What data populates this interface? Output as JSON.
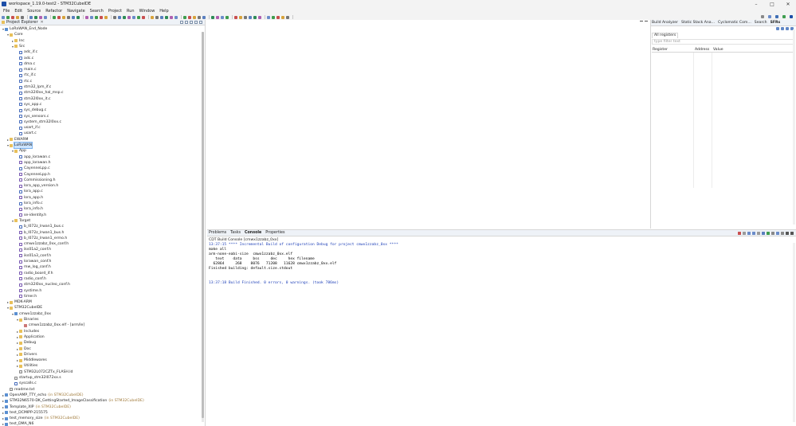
{
  "window": {
    "title": "workspace_1.19.0-test2 - STM32CubeIDE",
    "minimize": "–",
    "maximize": "□",
    "close": "✕"
  },
  "menu": [
    "File",
    "Edit",
    "Source",
    "Refactor",
    "Navigate",
    "Search",
    "Project",
    "Run",
    "Window",
    "Help"
  ],
  "colors": {
    "accent": "#1d4ea7",
    "selected": "#cce4ff",
    "console_info": "#1d3fb8",
    "decorator": "#a07a3a"
  },
  "project_explorer": {
    "tab_label": "Project Explorer",
    "close": "✕",
    "tree": [
      {
        "label": "LoRaWAN_End_Node",
        "depth": 0,
        "type": "project",
        "expanded": true
      },
      {
        "label": "Core",
        "depth": 1,
        "type": "folder",
        "expanded": true
      },
      {
        "label": "Inc",
        "depth": 2,
        "type": "folder",
        "expanded": false
      },
      {
        "label": "Src",
        "depth": 2,
        "type": "folder",
        "expanded": true
      },
      {
        "label": "adc_if.c",
        "depth": 3,
        "type": "cfile"
      },
      {
        "label": "adc.c",
        "depth": 3,
        "type": "cfile"
      },
      {
        "label": "dma.c",
        "depth": 3,
        "type": "cfile"
      },
      {
        "label": "main.c",
        "depth": 3,
        "type": "cfile"
      },
      {
        "label": "rtc_if.c",
        "depth": 3,
        "type": "cfile"
      },
      {
        "label": "rtc.c",
        "depth": 3,
        "type": "cfile"
      },
      {
        "label": "stm32_lpm_if.c",
        "depth": 3,
        "type": "cfile"
      },
      {
        "label": "stm32l0xx_hal_msp.c",
        "depth": 3,
        "type": "cfile"
      },
      {
        "label": "stm32l0xx_it.c",
        "depth": 3,
        "type": "cfile"
      },
      {
        "label": "sys_app.c",
        "depth": 3,
        "type": "cfile"
      },
      {
        "label": "sys_debug.c",
        "depth": 3,
        "type": "cfile"
      },
      {
        "label": "sys_sensors.c",
        "depth": 3,
        "type": "cfile"
      },
      {
        "label": "system_stm32l0xx.c",
        "depth": 3,
        "type": "cfile"
      },
      {
        "label": "usart_if.c",
        "depth": 3,
        "type": "cfile"
      },
      {
        "label": "usart.c",
        "depth": 3,
        "type": "cfile"
      },
      {
        "label": "EWARM",
        "depth": 1,
        "type": "folder",
        "expanded": false
      },
      {
        "label": "LoRaWAN",
        "depth": 1,
        "type": "folder",
        "expanded": true,
        "selected": true
      },
      {
        "label": "App",
        "depth": 2,
        "type": "folder",
        "expanded": true
      },
      {
        "label": "app_lorawan.c",
        "depth": 3,
        "type": "cfile"
      },
      {
        "label": "app_lorawan.h",
        "depth": 3,
        "type": "hfile"
      },
      {
        "label": "CayenneLpp.c",
        "depth": 3,
        "type": "cfile"
      },
      {
        "label": "CayenneLpp.h",
        "depth": 3,
        "type": "hfile"
      },
      {
        "label": "Commissioning.h",
        "depth": 3,
        "type": "hfile"
      },
      {
        "label": "lora_app_version.h",
        "depth": 3,
        "type": "hfile"
      },
      {
        "label": "lora_app.c",
        "depth": 3,
        "type": "cfile"
      },
      {
        "label": "lora_app.h",
        "depth": 3,
        "type": "hfile"
      },
      {
        "label": "lora_info.c",
        "depth": 3,
        "type": "cfile"
      },
      {
        "label": "lora_info.h",
        "depth": 3,
        "type": "hfile"
      },
      {
        "label": "se-identity.h",
        "depth": 3,
        "type": "hfile"
      },
      {
        "label": "Target",
        "depth": 2,
        "type": "folder",
        "expanded": true
      },
      {
        "label": "b_l072z_lrwan1_bus.c",
        "depth": 3,
        "type": "cfile"
      },
      {
        "label": "b_l072z_lrwan1_bus.h",
        "depth": 3,
        "type": "hfile"
      },
      {
        "label": "b_l072z_lrwan1_errno.h",
        "depth": 3,
        "type": "hfile"
      },
      {
        "label": "cmwx1zzabz_0xx_conf.h",
        "depth": 3,
        "type": "hfile"
      },
      {
        "label": "iks01a2_conf.h",
        "depth": 3,
        "type": "hfile"
      },
      {
        "label": "iks01a3_conf.h",
        "depth": 3,
        "type": "hfile"
      },
      {
        "label": "lorawan_conf.h",
        "depth": 3,
        "type": "hfile"
      },
      {
        "label": "mw_log_conf.h",
        "depth": 3,
        "type": "hfile"
      },
      {
        "label": "radio_board_if.h",
        "depth": 3,
        "type": "hfile"
      },
      {
        "label": "radio_conf.h",
        "depth": 3,
        "type": "hfile"
      },
      {
        "label": "stm32l0xx_nucleo_conf.h",
        "depth": 3,
        "type": "hfile"
      },
      {
        "label": "systime.h",
        "depth": 3,
        "type": "hfile"
      },
      {
        "label": "timer.h",
        "depth": 3,
        "type": "hfile"
      },
      {
        "label": "MDK-ARM",
        "depth": 1,
        "type": "folder",
        "expanded": false
      },
      {
        "label": "STM32CubeIDE",
        "depth": 1,
        "type": "folder",
        "expanded": true
      },
      {
        "label": "cmwx1zzabz_0xx",
        "depth": 2,
        "type": "project",
        "expanded": true
      },
      {
        "label": "Binaries",
        "depth": 3,
        "type": "folder",
        "expanded": true
      },
      {
        "label": "cmwx1zzabz_0xx.elf - [arm/le]",
        "depth": 4,
        "type": "binary"
      },
      {
        "label": "Includes",
        "depth": 3,
        "type": "folder",
        "expanded": false
      },
      {
        "label": "Application",
        "depth": 3,
        "type": "folder",
        "expanded": false
      },
      {
        "label": "Debug",
        "depth": 3,
        "type": "folder",
        "expanded": false
      },
      {
        "label": "Doc",
        "depth": 3,
        "type": "folder",
        "expanded": false
      },
      {
        "label": "Drivers",
        "depth": 3,
        "type": "folder",
        "expanded": false
      },
      {
        "label": "Middlewares",
        "depth": 3,
        "type": "folder",
        "expanded": false
      },
      {
        "label": "Utilities",
        "depth": 3,
        "type": "folder",
        "expanded": false
      },
      {
        "label": "STM32L072CZTx_FLASH.ld",
        "depth": 3,
        "type": "file"
      },
      {
        "label": "startup_stm32l072xx.s",
        "depth": 2,
        "type": "file"
      },
      {
        "label": "syscalls.c",
        "depth": 2,
        "type": "cfile"
      },
      {
        "label": "readme.txt",
        "depth": 1,
        "type": "file"
      },
      {
        "label": "OpenAMP_TTY_echo",
        "depth": 0,
        "type": "project",
        "expanded": false,
        "suffix": "(in STM32CubeIDE)"
      },
      {
        "label": "STM32N6570-DK_GettingStarted_ImageClassification",
        "depth": 0,
        "type": "project",
        "expanded": false,
        "suffix": "(in STM32CubeIDE)"
      },
      {
        "label": "Template_XIP",
        "depth": 0,
        "type": "project",
        "expanded": false,
        "suffix": "(in STM32CubeIDE)"
      },
      {
        "label": "test_DCMIPP-215575",
        "depth": 0,
        "type": "project",
        "expanded": false
      },
      {
        "label": "test_memory_size",
        "depth": 0,
        "type": "project",
        "expanded": false,
        "suffix": "(in STM32CubeIDE)"
      },
      {
        "label": "test_DMA_N6",
        "depth": 0,
        "type": "project",
        "expanded": false
      }
    ]
  },
  "right_panel": {
    "tabs": [
      "Build Analyzer",
      "Static Stack Ana...",
      "Cyclomatic Com...",
      "Search",
      "SFRs"
    ],
    "active_tab": 4,
    "registers_tab": "All registers",
    "filter_placeholder": "type filter text",
    "columns": [
      "Register",
      "Address",
      "Value"
    ]
  },
  "bottom_panel": {
    "tabs": [
      "Problems",
      "Tasks",
      "Console",
      "Properties"
    ],
    "active_tab": 2,
    "console_title": "CDT Build Console [cmwx1zzabz_0xx]",
    "lines": [
      {
        "text": "13:37:15 **** Incremental Build of configuration Debug for project cmwx1zzabz_0xx ****",
        "kind": "info"
      },
      {
        "text": "make all",
        "kind": "plain"
      },
      {
        "text": "arm-none-eabi-size  cmwx1zzabz_0xx.elf",
        "kind": "plain"
      },
      {
        "text": "   text    data     bss     dec     hex filename",
        "kind": "plain"
      },
      {
        "text": "  62864     268    8076   71208   11628 cmwx1zzabz_0xx.elf",
        "kind": "plain"
      },
      {
        "text": "Finished building: default.size.stdout",
        "kind": "plain"
      },
      {
        "text": " ",
        "kind": "plain"
      },
      {
        "text": " ",
        "kind": "plain"
      },
      {
        "text": "13:37:18 Build Finished. 0 errors, 0 warnings. (took 786ms)",
        "kind": "info"
      }
    ]
  }
}
